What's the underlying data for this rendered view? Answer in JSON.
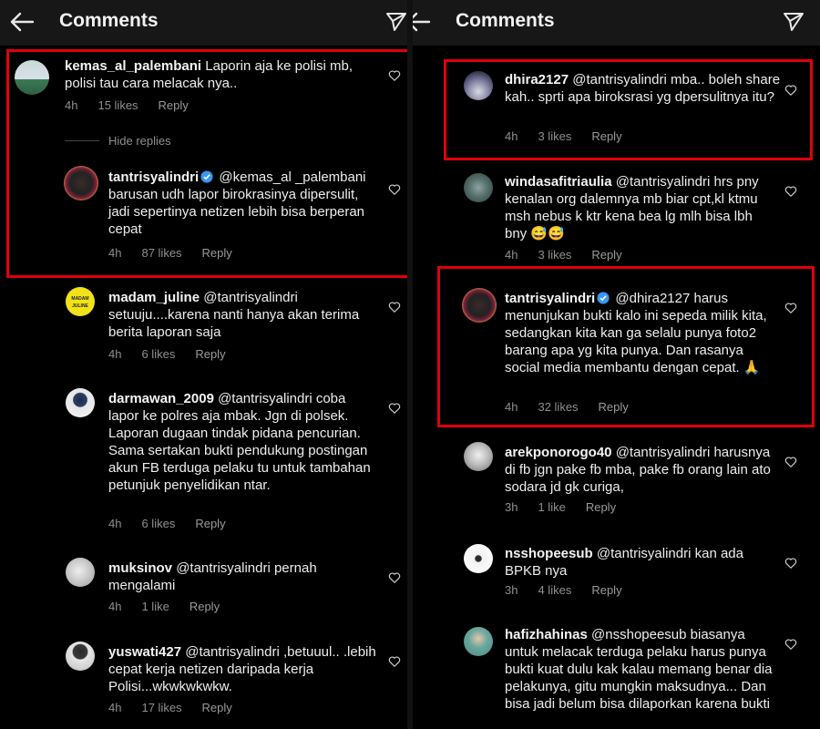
{
  "left": {
    "title": "Comments",
    "hide_replies": "Hide replies",
    "comments": [
      {
        "user": "kemas_al_palembani",
        "text": " Laporin aja ke polisi mb, polisi tau cara melacak nya..",
        "time": "4h",
        "likes": "15 likes",
        "reply": "Reply"
      },
      {
        "user": "tantrisyalindri",
        "text": " @kemas_al _palembani barusan udh lapor birokrasinya dipersulit, jadi sepertinya netizen lebih bisa berperan cepat",
        "time": "4h",
        "likes": "87 likes",
        "reply": "Reply"
      },
      {
        "user": "madam_juline",
        "text": " @tantrisyalindri setuuju....karena nanti hanya akan terima berita laporan saja",
        "time": "4h",
        "likes": "6 likes",
        "reply": "Reply"
      },
      {
        "user": "darmawan_2009",
        "text": " @tantrisyalindri coba lapor ke polres aja mbak. Jgn di polsek. Laporan dugaan tindak pidana pencurian. Sama sertakan bukti pendukung postingan akun FB terduga pelaku tu untuk tambahan petunjuk penyelidikan ntar.",
        "time": "4h",
        "likes": "6 likes",
        "reply": "Reply"
      },
      {
        "user": "muksinov",
        "text": " @tantrisyalindri pernah mengalami",
        "time": "4h",
        "likes": "1 like",
        "reply": "Reply"
      },
      {
        "user": "yuswati427",
        "text": " @tantrisyalindri ,betuuul.. .lebih cepat kerja netizen daripada kerja Polisi...wkwkwkwkw.",
        "time": "4h",
        "likes": "17 likes",
        "reply": "Reply"
      }
    ]
  },
  "right": {
    "title": "Comments",
    "comments": [
      {
        "user": "dhira2127",
        "text": " @tantrisyalindri mba.. boleh share kah.. sprti apa biroksrasi yg dpersulitnya itu?",
        "time": "4h",
        "likes": "3 likes",
        "reply": "Reply"
      },
      {
        "user": "windasafitriaulia",
        "text": " @tantrisyalindri hrs pny kenalan org dalemnya mb biar cpt,kl ktmu msh nebus k ktr kena bea lg mlh bisa lbh bny 😅😅",
        "time": "4h",
        "likes": "3 likes",
        "reply": "Reply"
      },
      {
        "user": "tantrisyalindri",
        "text": " @dhira2127 harus menunjukan bukti kalo ini sepeda milik kita, sedangkan kita kan ga selalu punya foto2 barang apa yg kita punya. Dan rasanya social media membantu dengan cepat. 🙏",
        "time": "4h",
        "likes": "32 likes",
        "reply": "Reply"
      },
      {
        "user": "arekponorogo40",
        "text": " @tantrisyalindri harusnya di fb jgn pake fb mba, pake fb orang lain ato sodara jd gk curiga,",
        "time": "3h",
        "likes": "1 like",
        "reply": "Reply"
      },
      {
        "user": "nsshopeesub",
        "text": " @tantrisyalindri kan ada BPKB nya",
        "time": "3h",
        "likes": "4 likes",
        "reply": "Reply"
      },
      {
        "user": "hafizhahinas",
        "text": " @nsshopeesub biasanya untuk melacak terduga pelaku harus punya bukti kuat dulu kak kalau memang benar dia pelakunya, gitu mungkin maksudnya... Dan bisa jadi belum bisa dilaporkan karena bukti",
        "time": "",
        "likes": "",
        "reply": ""
      }
    ]
  },
  "avatars": {
    "madam_juline_text": "MADAM JULINE"
  },
  "colors": {
    "highlight": "#e0000b",
    "verified": "#3897f0",
    "header_bg": "#171717"
  }
}
